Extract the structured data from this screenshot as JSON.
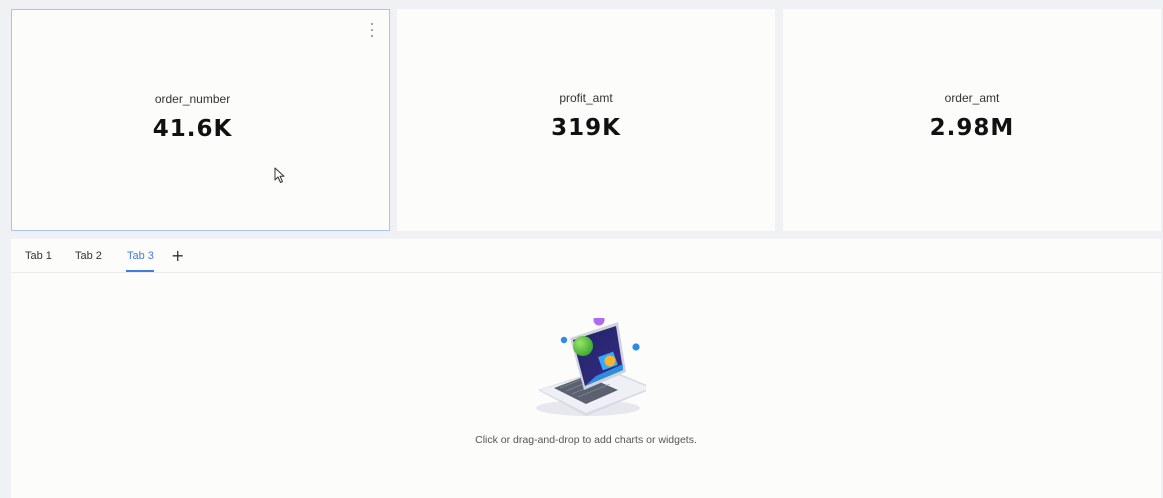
{
  "kpis": [
    {
      "label": "order_number",
      "value": "41.6K"
    },
    {
      "label": "profit_amt",
      "value": "319K"
    },
    {
      "label": "order_amt",
      "value": "2.98M"
    }
  ],
  "tabs": [
    {
      "label": "Tab 1"
    },
    {
      "label": "Tab 2"
    },
    {
      "label": "Tab 3",
      "active": true
    }
  ],
  "add_tab_label": "+",
  "empty_state": {
    "message": "Click or drag-and-drop to add charts or widgets."
  },
  "icons": {
    "card_menu": "more-vertical-icon",
    "cursor": "mouse-pointer-icon",
    "illustration": "laptop-illustration"
  },
  "colors": {
    "accent": "#3d7ee0",
    "selected_border": "#a9c4ec",
    "background": "#f0f1f5",
    "card": "#fcfcfb"
  }
}
